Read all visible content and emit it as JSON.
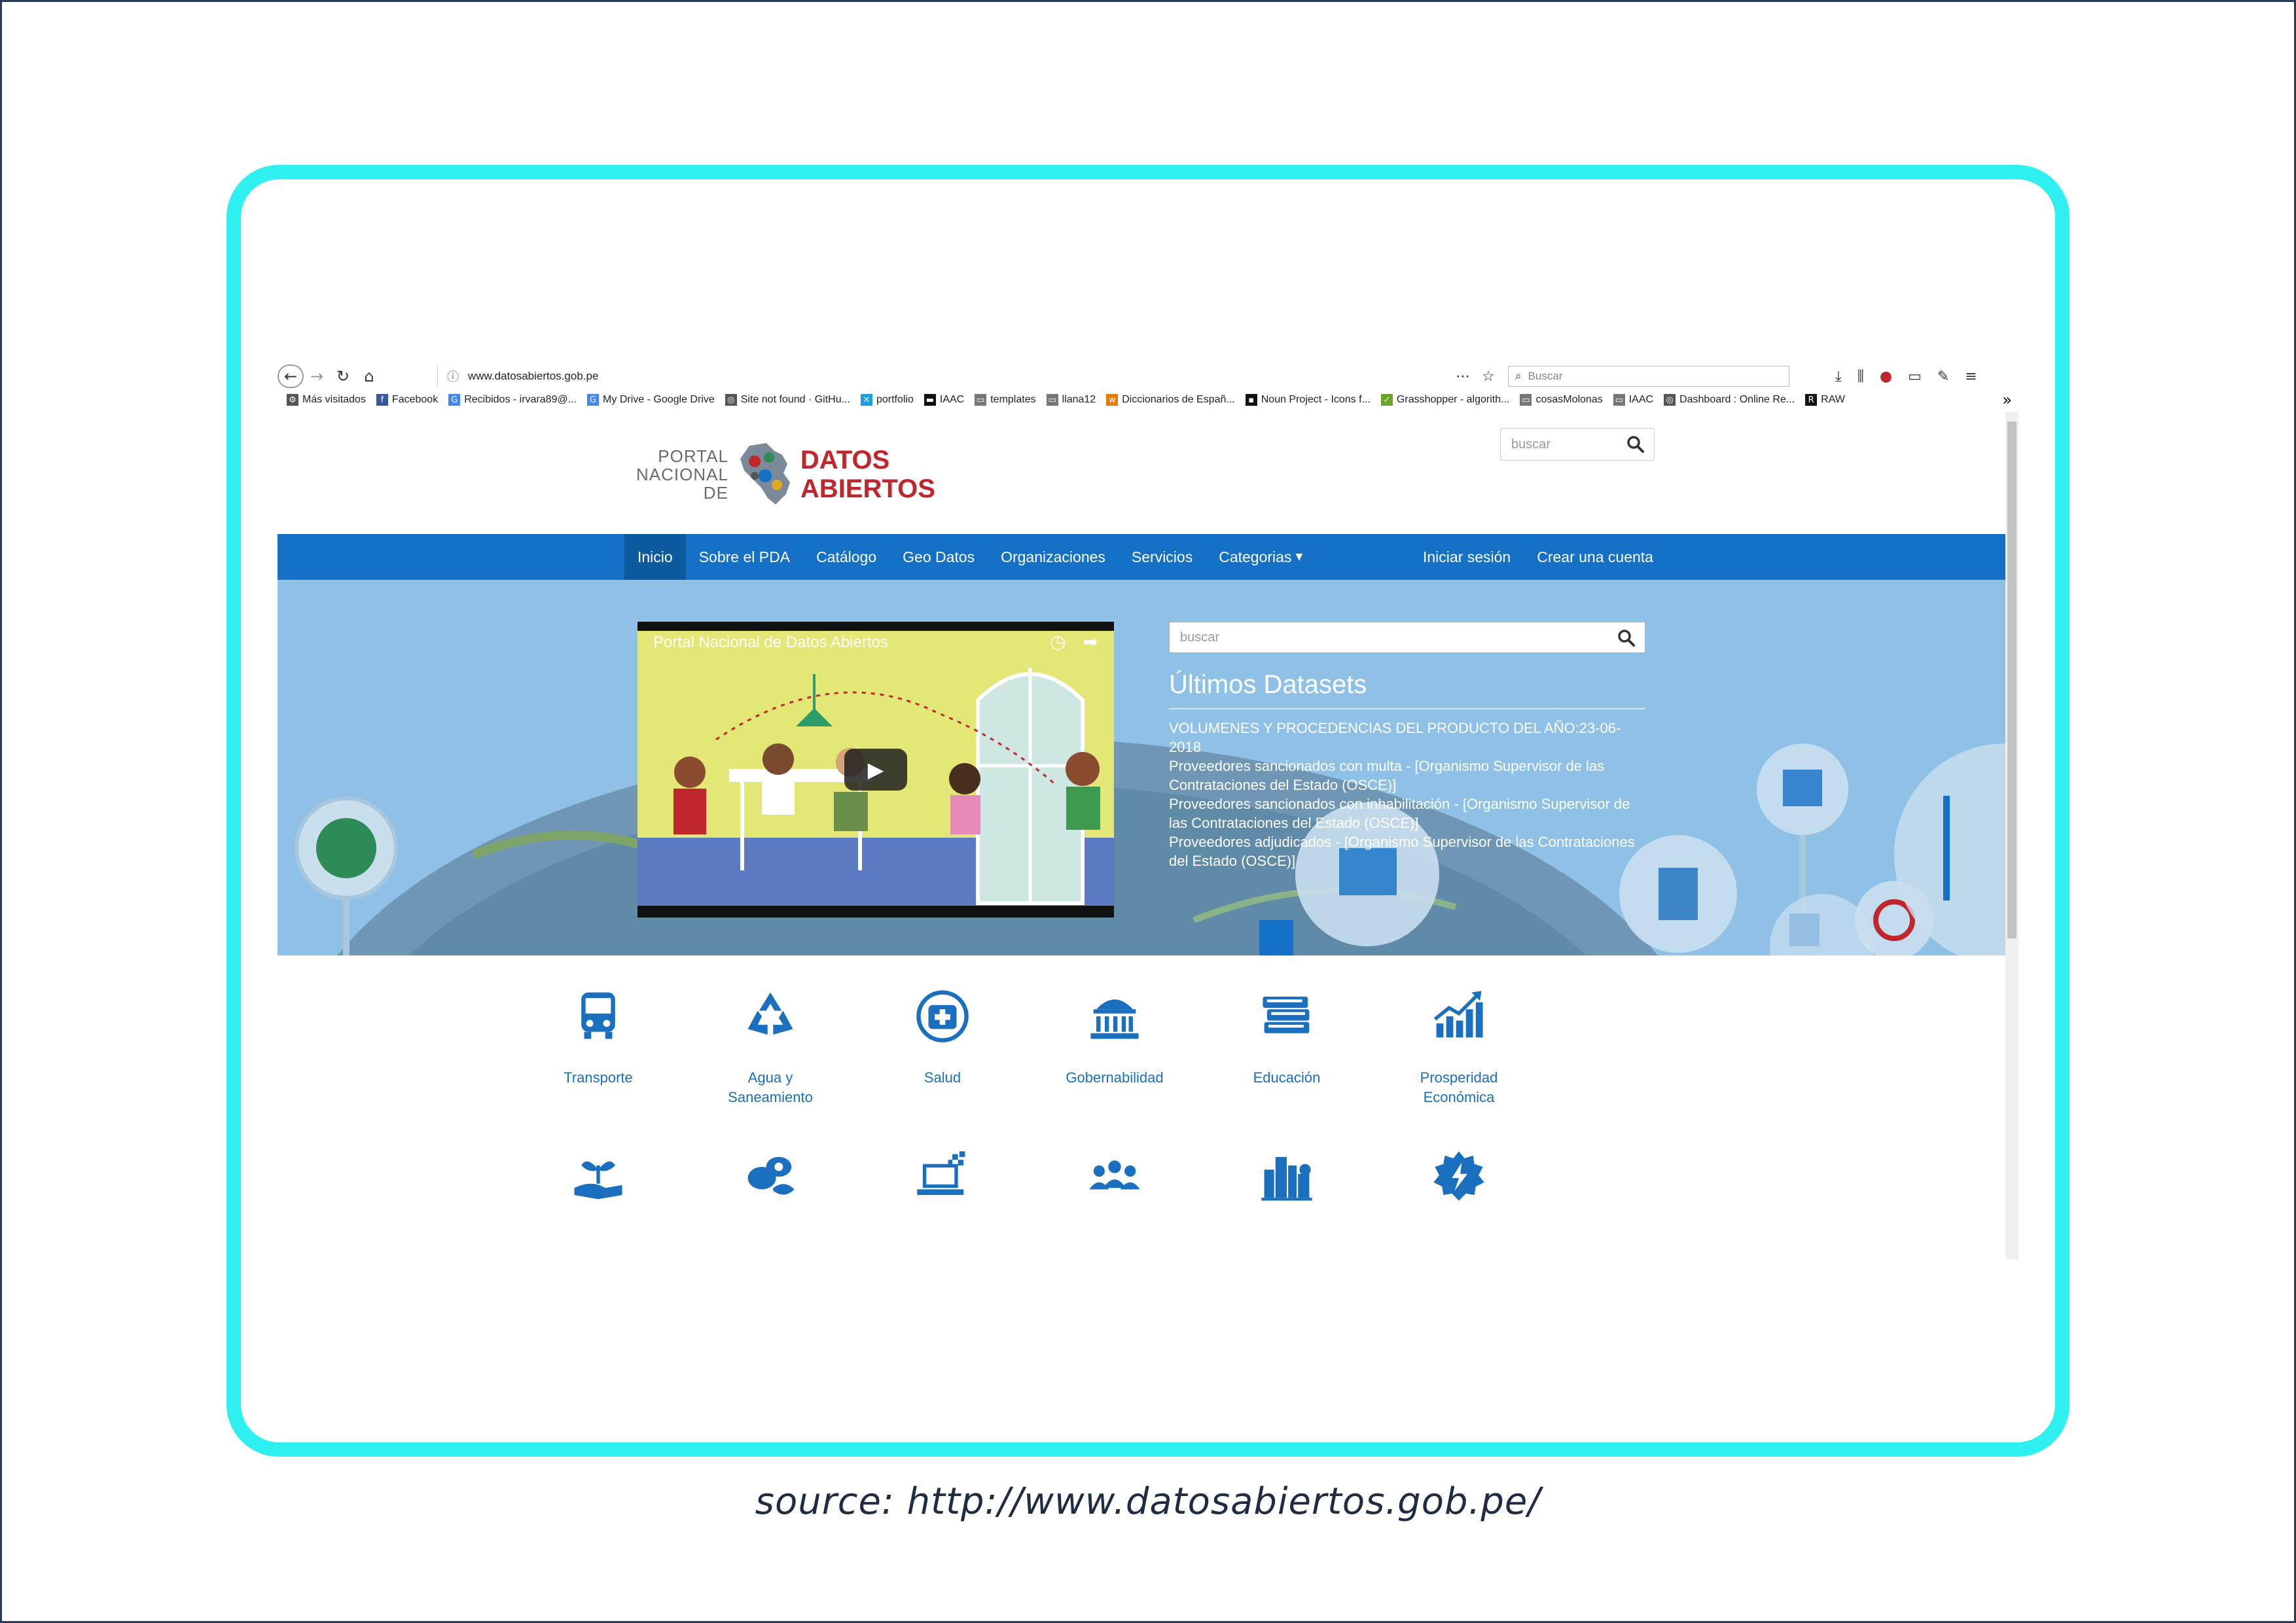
{
  "caption": "source: http://www.datosabiertos.gob.pe/",
  "browser": {
    "url": "www.datosabiertos.gob.pe",
    "search_placeholder": "Buscar",
    "tool_icons": [
      "back-arrow-icon",
      "forward-arrow-icon",
      "reload-icon",
      "home-icon",
      "more-icon",
      "star-icon",
      "download-icon",
      "library-icon",
      "addon-icon",
      "sidebar-icon",
      "pen-icon",
      "menu-icon"
    ],
    "bookmarks": [
      {
        "label": "Más visitados",
        "icon": "gear-icon"
      },
      {
        "label": "Facebook",
        "icon": "facebook-icon"
      },
      {
        "label": "Recibidos - irvara89@...",
        "icon": "google-icon"
      },
      {
        "label": "My Drive - Google Drive",
        "icon": "google-icon"
      },
      {
        "label": "Site not found · GitHu...",
        "icon": "globe-icon"
      },
      {
        "label": "portfolio",
        "icon": "bookmark-icon"
      },
      {
        "label": "IAAC",
        "icon": "iaac-icon"
      },
      {
        "label": "templates",
        "icon": "folder-icon"
      },
      {
        "label": "llana12",
        "icon": "folder-icon"
      },
      {
        "label": "Diccionarios de Españ...",
        "icon": "wr-icon"
      },
      {
        "label": "Noun Project - Icons f...",
        "icon": "noun-icon"
      },
      {
        "label": "Grasshopper - algorith...",
        "icon": "grasshopper-icon"
      },
      {
        "label": "cosasMolonas",
        "icon": "folder-icon"
      },
      {
        "label": "IAAC",
        "icon": "folder-icon"
      },
      {
        "label": "Dashboard : Online Re...",
        "icon": "globe-icon"
      },
      {
        "label": "RAW",
        "icon": "raw-icon"
      }
    ]
  },
  "site": {
    "logo": {
      "small": [
        "PORTAL",
        "NACIONAL",
        "DE"
      ],
      "big": [
        "DATOS",
        "ABIERTOS"
      ],
      "red": "#c0272d"
    },
    "top_search_placeholder": "buscar",
    "nav": {
      "items": [
        "Inicio",
        "Sobre el PDA",
        "Catálogo",
        "Geo Datos",
        "Organizaciones",
        "Servicios",
        "Categorias"
      ],
      "right": [
        "Iniciar sesión",
        "Crear una cuenta"
      ],
      "color": "#1471c5"
    },
    "video_title": "Portal Nacional de Datos Abiertos",
    "hero_search_placeholder": "buscar",
    "datasets_title": "Últimos Datasets",
    "datasets": [
      "VOLUMENES Y PROCEDENCIAS DEL PRODUCTO DEL AÑO:23-06-2018",
      "Proveedores sancionados con multa - [Organismo Supervisor de las Contrataciones del Estado (OSCE)]",
      "Proveedores sancionados con inhabilitación - [Organismo Supervisor de las Contrataciones del Estado (OSCE)]",
      "Proveedores adjudicados - [Organismo Supervisor de las Contrataciones del Estado (OSCE)]"
    ],
    "categories": [
      {
        "label": "Transporte",
        "icon": "bus-icon"
      },
      {
        "label": "Agua y Saneamiento",
        "icon": "recycle-icon"
      },
      {
        "label": "Salud",
        "icon": "health-kit-icon"
      },
      {
        "label": "Gobernabilidad",
        "icon": "government-building-icon"
      },
      {
        "label": "Educación",
        "icon": "books-icon"
      },
      {
        "label": "Prosperidad Económica",
        "icon": "growth-chart-icon"
      },
      {
        "label": "",
        "icon": "hand-plant-icon"
      },
      {
        "label": "",
        "icon": "food-icon"
      },
      {
        "label": "",
        "icon": "laptop-data-icon"
      },
      {
        "label": "",
        "icon": "people-group-icon"
      },
      {
        "label": "",
        "icon": "city-icon"
      },
      {
        "label": "",
        "icon": "energy-gear-icon"
      }
    ],
    "icon_color": "#1a6fbe"
  }
}
